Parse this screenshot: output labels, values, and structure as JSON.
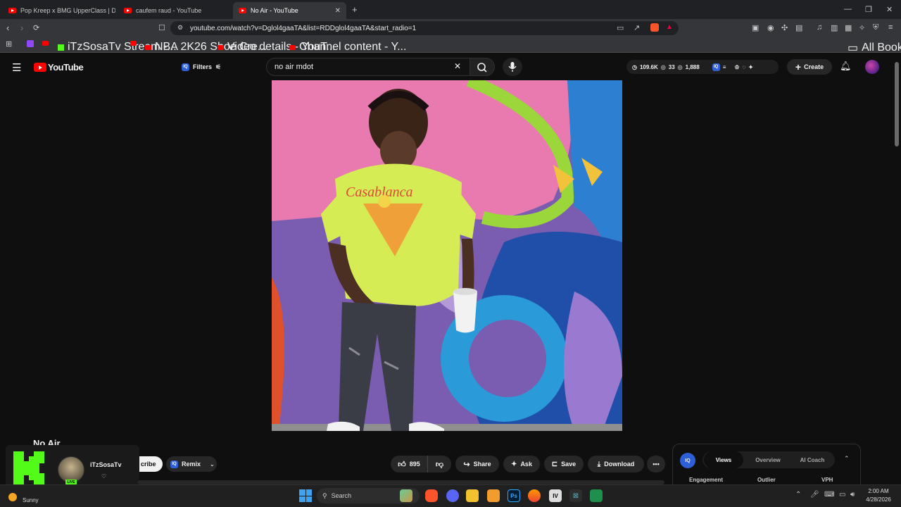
{
  "browser": {
    "tabs": [
      {
        "title": "Pop Kreep x BMG UpperClass | Drill M"
      },
      {
        "title": "caufem raud - YouTube"
      },
      {
        "title": "No Air - YouTube"
      }
    ],
    "url": "youtube.com/watch?v=Dglol4gaaTA&list=RDDglol4gaaTA&start_radio=1",
    "bookmarks": [
      {
        "label": "iTzSosaTv Stream -..."
      },
      {
        "label": "NBA 2K26 Shoe Cre..."
      },
      {
        "label": "Video details - YouT..."
      },
      {
        "label": "Channel content - Y..."
      }
    ],
    "all_bookmarks": "All Bookmarks"
  },
  "youtube": {
    "logo": "YouTube",
    "filters_label": "Filters",
    "search_value": "no air mdot",
    "stats": {
      "views": "109.6K",
      "count2": "33",
      "count3": "1,888"
    },
    "create_label": "Create"
  },
  "video": {
    "title": "No Air",
    "channel": "iTzSosaTv",
    "subscribe_label": "cribe",
    "remix_label": "Remix",
    "live_badge": "LIVE",
    "likes": "895",
    "share_label": "Share",
    "ask_label": "Ask",
    "save_label": "Save",
    "download_label": "Download"
  },
  "vidiq": {
    "tabs": [
      "Views",
      "Overview",
      "AI Coach"
    ],
    "columns": [
      "Engagement",
      "Outlier",
      "VPH"
    ]
  },
  "taskbar": {
    "weather": "Sunny",
    "search_label": "Search",
    "time": "2:00 AM",
    "date": "4/28/2026"
  },
  "colors": {
    "accent": "#ff0000",
    "kick": "#53fc18",
    "vidiq": "#2f5fd6"
  }
}
